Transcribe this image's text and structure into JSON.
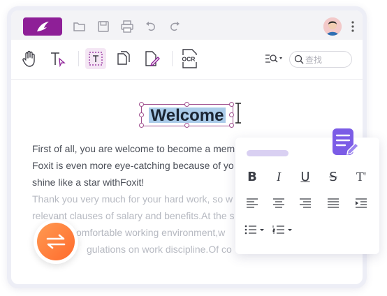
{
  "colors": {
    "brand": "#8e1f97",
    "selection": "#aacbe9",
    "accent": "#7b5ce6",
    "convert": "#ff7a3a"
  },
  "titlebar": {
    "icons": [
      "logo-icon",
      "open-folder-icon",
      "save-icon",
      "print-icon",
      "undo-icon",
      "redo-icon"
    ],
    "menu": "more-options-icon"
  },
  "toolbar": {
    "tools": [
      "hand-tool-icon",
      "select-text-tool-icon",
      "edit-text-tool-icon",
      "organize-pages-icon",
      "edit-page-icon",
      "ocr-tool-icon"
    ],
    "ocr_label": "OCR",
    "search_placeholder": "查找"
  },
  "document": {
    "heading": "Welcome",
    "lines": [
      "First of all, you are welcome to become a mem",
      "Foxit is even more eye-catching because of yo",
      "shine like a star withFoxit!",
      "Thank you very much for your hard work, so w",
      "relevant clauses of salary and benefits.At the s",
      "comfortable working environment,w",
      "gulations on work discipline.Of co"
    ]
  },
  "format_popup": {
    "row1": [
      "B",
      "I",
      "U",
      "S",
      "T'"
    ],
    "row2": [
      "align-left-icon",
      "align-center-icon",
      "align-right-icon",
      "justify-icon",
      "indent-icon"
    ],
    "row3": [
      "bulleted-list-icon",
      "numbered-list-icon"
    ]
  }
}
